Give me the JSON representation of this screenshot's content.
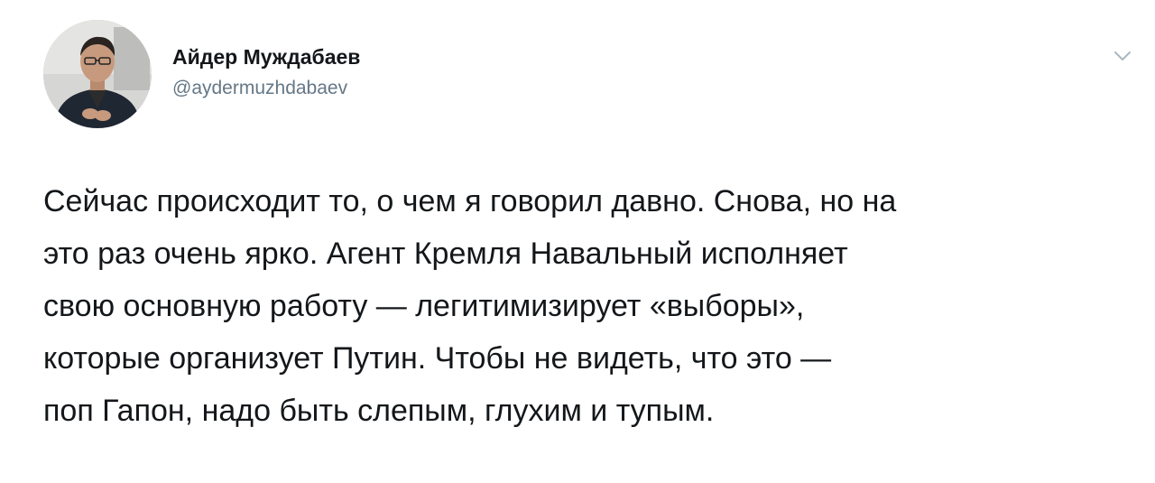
{
  "author": {
    "name": "Айдер Муждабаев",
    "handle": "@aydermuzhdabaev"
  },
  "icons": {
    "avatar": "profile-photo",
    "menu": "chevron-down-icon"
  },
  "colors": {
    "text": "#14171a",
    "secondary": "#657786",
    "chevron": "#aab8c2"
  },
  "tweet": {
    "lines": [
      "Сейчас происходит то, о чем я говорил давно. Снова, но на",
      "это раз очень ярко. Агент Кремля Навальный исполняет",
      "свою основную работу — легитимизирует «выборы»,",
      "которые организует Путин. Чтобы не видеть, что это —",
      "поп Гапон, надо быть слепым, глухим и тупым."
    ]
  }
}
